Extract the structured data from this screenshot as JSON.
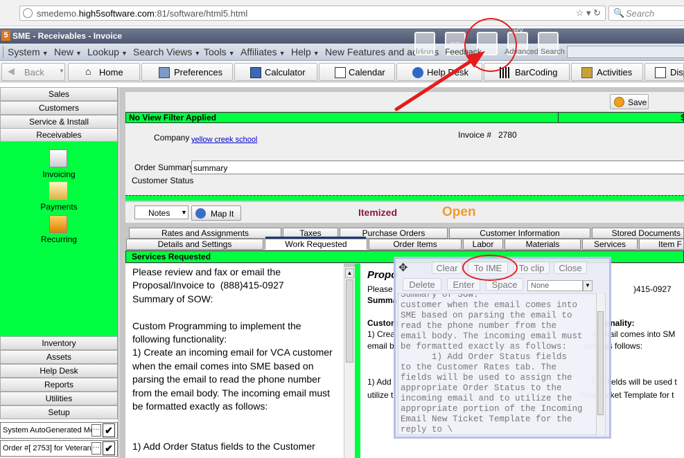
{
  "browser": {
    "url_prefix": "smedemo.",
    "url_domain": "high5software.com",
    "url_suffix": ":81/software/html5.html",
    "search_placeholder": "Search"
  },
  "app": {
    "logo": "5",
    "title": "SME - Receivables - Invoice"
  },
  "menu": [
    {
      "label": "System"
    },
    {
      "label": "New"
    },
    {
      "label": "Lookup"
    },
    {
      "label": "Search Views"
    },
    {
      "label": "Tools"
    },
    {
      "label": "Affiliates"
    },
    {
      "label": "Help"
    },
    {
      "label": "New Features and addons"
    }
  ],
  "overlay": {
    "srv": "SRV",
    "po": "PO",
    "feedback": "Feedback",
    "advanced_search": "Advanced Search"
  },
  "toolbar": {
    "back": "Back",
    "home": "Home",
    "preferences": "Preferences",
    "calculator": "Calculator",
    "calendar": "Calendar",
    "help_desk": "Help Desk",
    "barcoding": "BarCoding",
    "activities": "Activities",
    "display": "Disp"
  },
  "sidebar": {
    "top": [
      "Sales",
      "Customers",
      "Service & Install",
      "Receivables"
    ],
    "icons": [
      "Invoicing",
      "Payments",
      "Recurring"
    ],
    "bottom": [
      "Inventory",
      "Assets",
      "Help Desk",
      "Reports",
      "Utilities",
      "Setup"
    ],
    "records": [
      "System AutoGenerated Me",
      "Order #[ 2753] for Veteran"
    ]
  },
  "form": {
    "save": "Save",
    "view_filter": "No View Filter Applied",
    "view_filter_right": "S",
    "company_label": "Company",
    "company_value": "yellow creek school",
    "invoice_label": "Invoice #",
    "invoice_value": "2780",
    "order_summary_label": "Order Summary",
    "order_summary_value": "summary",
    "customer_status_label": "Customer Status"
  },
  "status": {
    "notes": "Notes",
    "map_it": "Map It",
    "itemized": "Itemized",
    "open": "Open"
  },
  "tabs_row1": [
    "Rates and Assignments",
    "Taxes",
    "Purchase Orders",
    "Customer Information",
    "Stored Documents"
  ],
  "tabs_row2": [
    "Details and Settings",
    "Work Requested",
    "Order Items",
    "Labor",
    "Materials",
    "Services",
    "Item F"
  ],
  "services": {
    "header": "Services Requested",
    "left_text": "Please review and fax or email the\nProposal/Invoice to  (888)415-0927\nSummary of SOW:\n\nCustom Programming to implement the following functionality:\n1) Create an incoming email for VCA customer when the email comes into SME based on parsing the email to read the phone number from the email body. The incoming email must be formatted exactly as follows:\n\n\n1) Add Order Status fields to the Customer",
    "right": {
      "title": "Propo",
      "line1a": "Please",
      "line1b": ")415-0927",
      "line2": "Summa",
      "line3a": "Custom",
      "line3b": "onality:",
      "line4a": "1) Crea",
      "line4b": "e email comes into SM",
      "line5a": "email b",
      "line5b": "actly as follows:",
      "line6a": "1) Add",
      "line6b": "The fields will be used t",
      "line7a": "utilize t",
      "line7b": "New Ticket Template for t"
    }
  },
  "clip": {
    "clear": "Clear",
    "to_ime": "To IME",
    "to_clip": "To clip",
    "close": "Close",
    "delete": "Delete",
    "enter": "Enter",
    "space": "Space",
    "none": "None",
    "text": "Summary of SOW:\ncustomer when the email comes into\nSME based on parsing the email to\nread the phone number from the\nemail body. The incoming email must\nbe formatted exactly as follows:\n      1) Add Order Status fields\nto the Customer Rates tab. The\nfields will be used to assign the\nappropriate Order Status to the\nincoming email and to utilize the\nappropriate portion of the Incoming\nEmail New Ticket Template for the\nreply to \\"
  },
  "colors": {
    "accent_green": "#00ff40",
    "annotation_red": "#e41c1c",
    "open_orange": "#f29a2e",
    "itemized_maroon": "#8b1a3a"
  }
}
